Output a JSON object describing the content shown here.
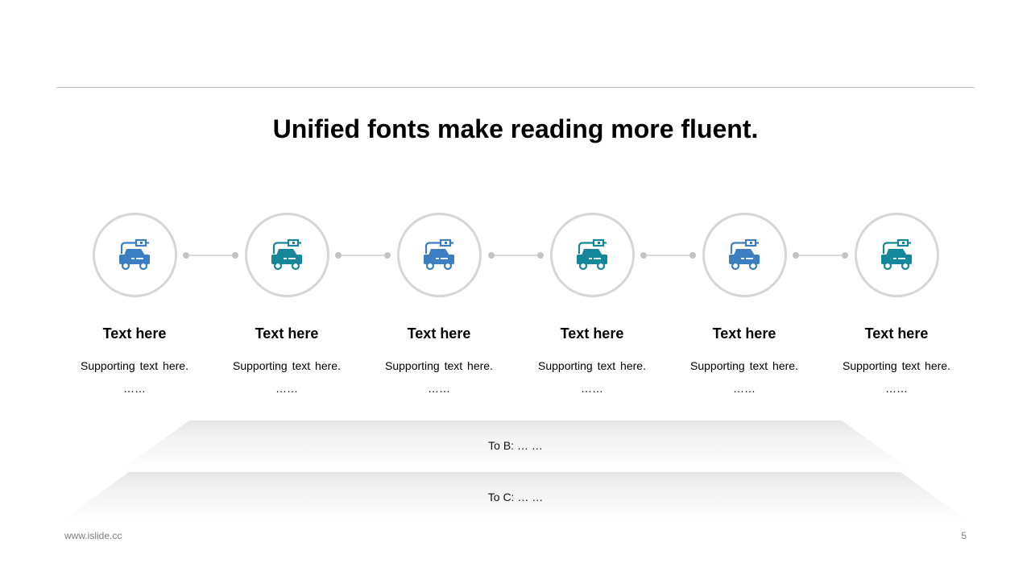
{
  "title": "Unified fonts make reading more fluent.",
  "steps": [
    {
      "label": "Text here",
      "desc": "Supporting text here.",
      "more": "……",
      "icon": "electric-car-icon",
      "color": "#3b7ec2"
    },
    {
      "label": "Text here",
      "desc": "Supporting text here.",
      "more": "……",
      "icon": "electric-car-icon",
      "color": "#15879a"
    },
    {
      "label": "Text here",
      "desc": "Supporting text here.",
      "more": "……",
      "icon": "electric-car-icon",
      "color": "#3b7ec2"
    },
    {
      "label": "Text here",
      "desc": "Supporting text here.",
      "more": "……",
      "icon": "electric-car-icon",
      "color": "#15879a"
    },
    {
      "label": "Text here",
      "desc": "Supporting text here.",
      "more": "……",
      "icon": "electric-car-icon",
      "color": "#3b7ec2"
    },
    {
      "label": "Text here",
      "desc": "Supporting text here.",
      "more": "……",
      "icon": "electric-car-icon",
      "color": "#15879a"
    }
  ],
  "bands": [
    {
      "text": "To B: … …"
    },
    {
      "text": "To C: … …"
    }
  ],
  "footer": {
    "url": "www.islide.cc",
    "page": "5"
  }
}
